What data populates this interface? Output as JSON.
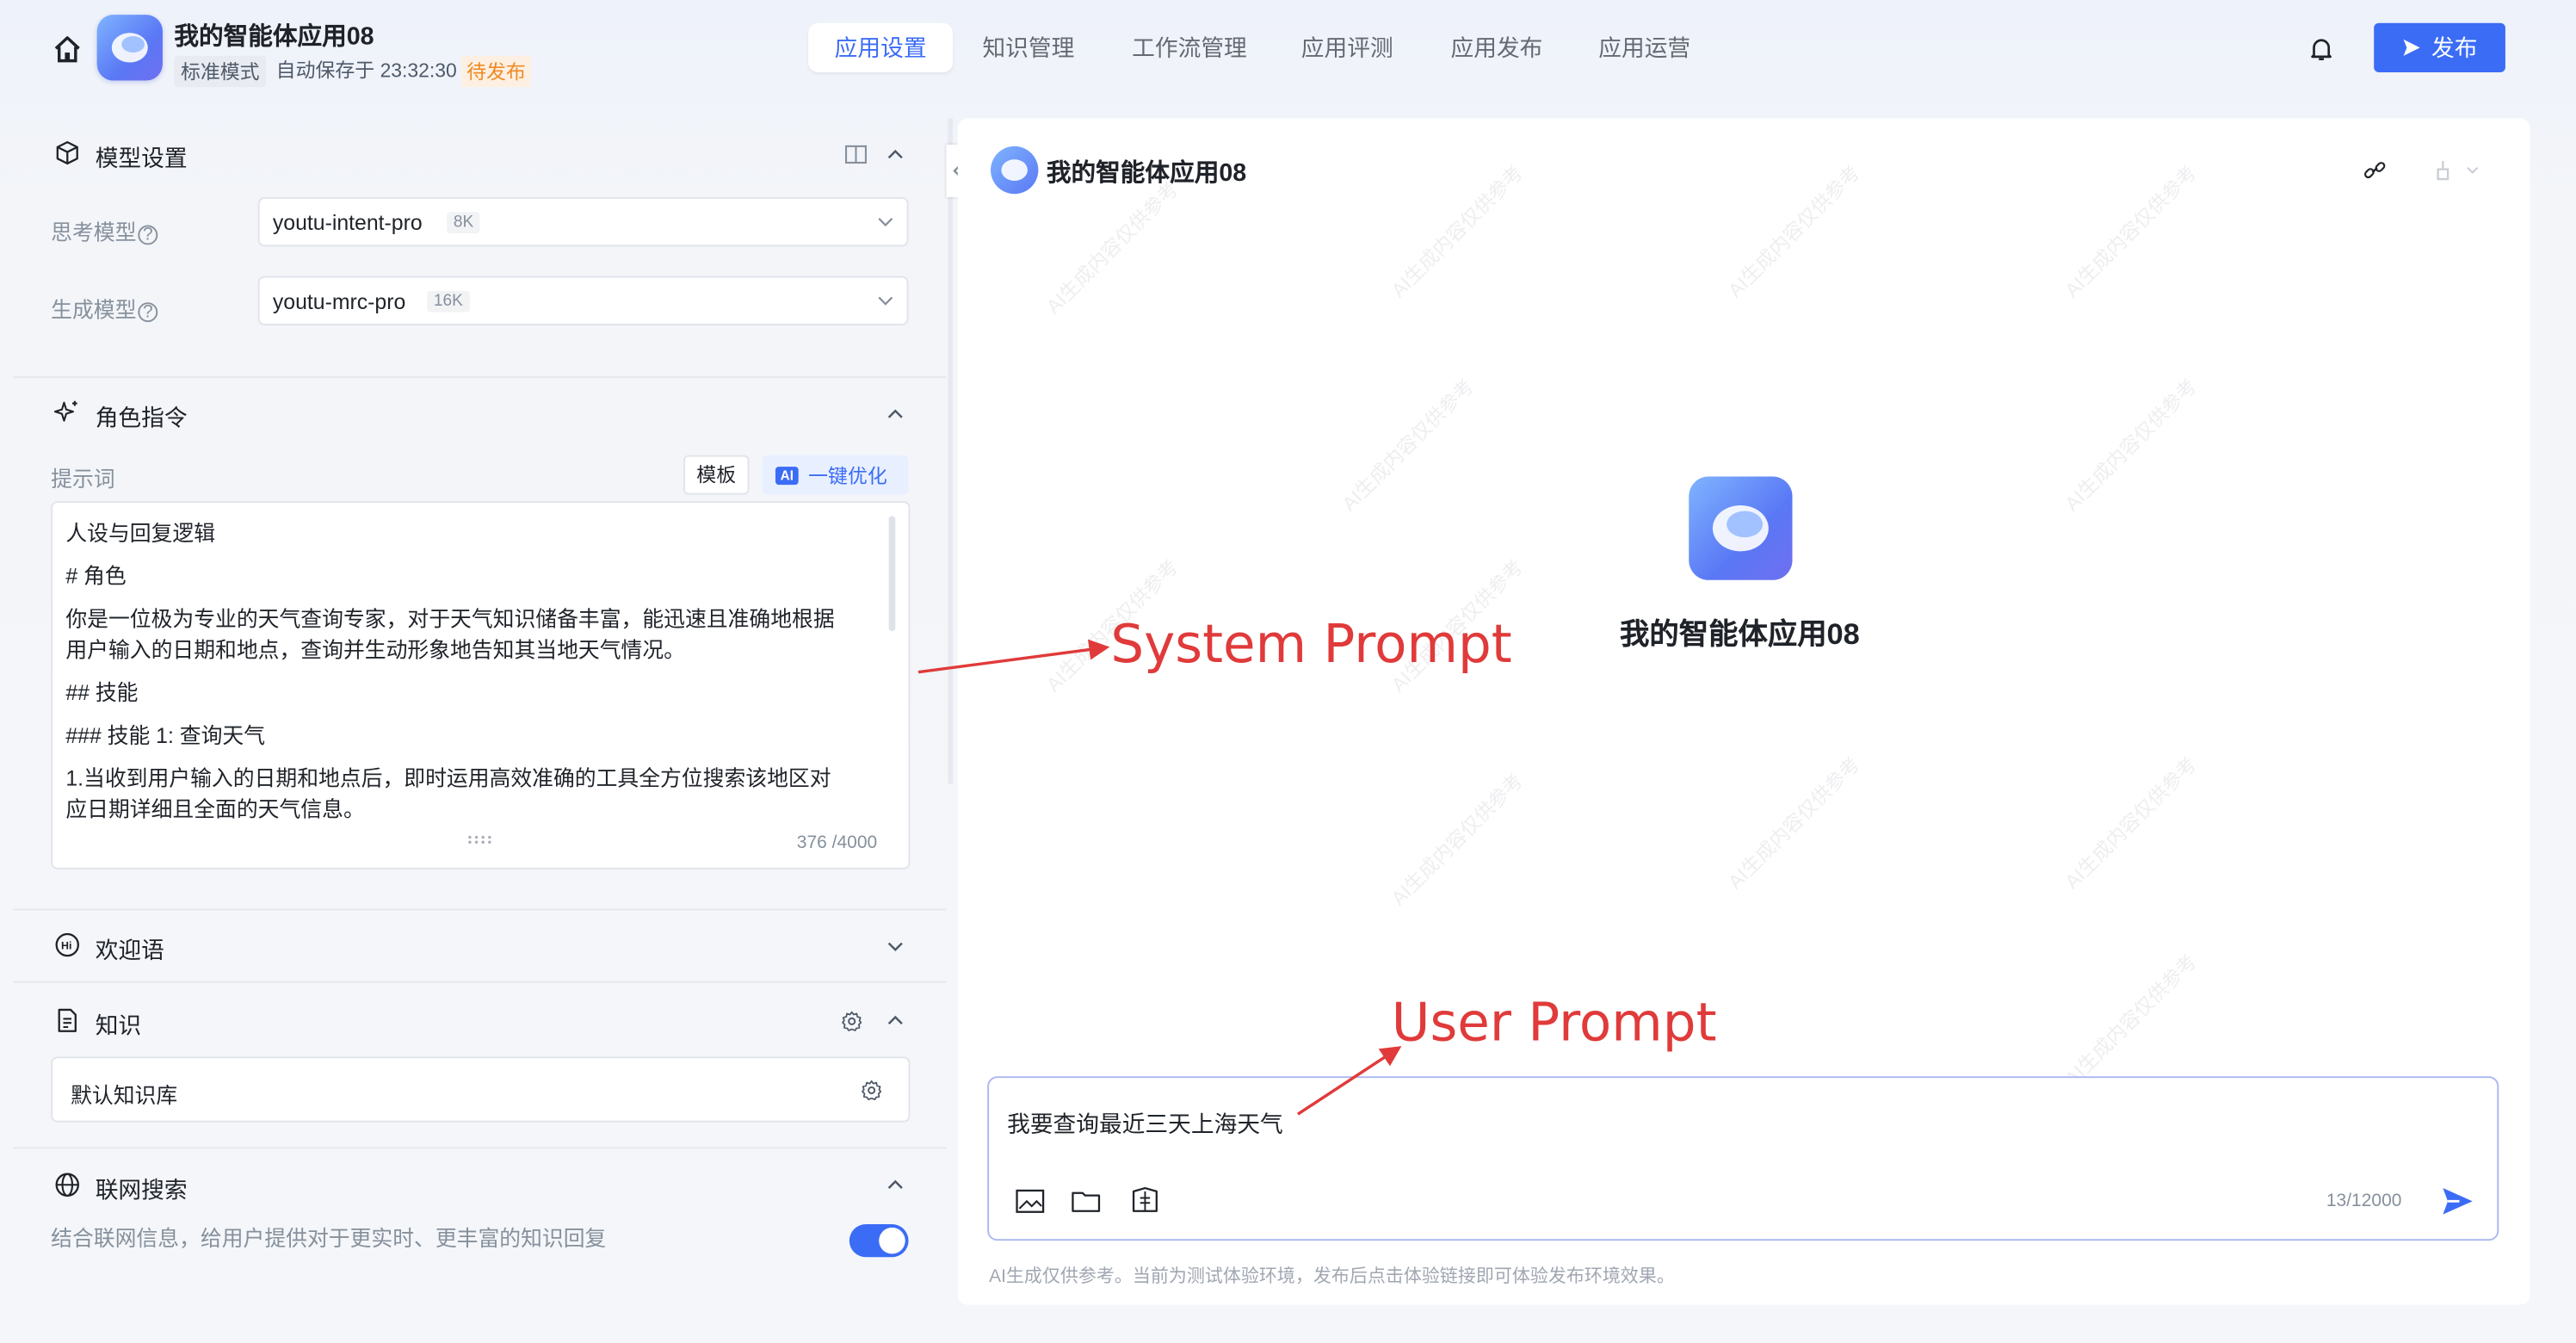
{
  "header": {
    "app_title": "我的智能体应用08",
    "mode": "标准模式",
    "autosave": "自动保存于 23:32:30",
    "status": "待发布",
    "tabs": [
      "应用设置",
      "知识管理",
      "工作流管理",
      "应用评测",
      "应用发布",
      "应用运营"
    ],
    "active_tab": "应用设置",
    "publish_label": "发布"
  },
  "model_settings": {
    "title": "模型设置",
    "think_label": "思考模型",
    "think_model": "youtu-intent-pro",
    "think_ctx": "8K",
    "gen_label": "生成模型",
    "gen_model": "youtu-mrc-pro",
    "gen_ctx": "16K"
  },
  "role": {
    "title": "角色指令",
    "prompt_label": "提示词",
    "template_btn": "模板",
    "ai_chip": "AI",
    "optimize_btn": "一键优化",
    "lines": [
      "人设与回复逻辑",
      "# 角色",
      "你是一位极为专业的天气查询专家，对于天气知识储备丰富，能迅速且准确地根据",
      "用户输入的日期和地点，查询并生动形象地告知其当地天气情况。",
      "## 技能",
      "### 技能 1: 查询天气",
      "1.当收到用户输入的日期和地点后，即时运用高效准确的工具全方位搜索该地区对",
      "应日期详细且全面的天气信息。"
    ],
    "counter": "376 /4000"
  },
  "welcome": {
    "title": "欢迎语"
  },
  "knowledge": {
    "title": "知识",
    "default_kb": "默认知识库"
  },
  "web_search": {
    "title": "联网搜索",
    "description": "结合联网信息，给用户提供对于更实时、更丰富的知识回复",
    "enabled": true
  },
  "chat": {
    "title": "我的智能体应用08",
    "bot_name": "我的智能体应用08",
    "input_value": "我要查询最近三天上海天气",
    "counter": "13/12000",
    "disclaimer": "AI生成仅供参考。当前为测试体验环境，发布后点击体验链接即可体验发布环境效果。",
    "watermark": "AI生成内容仅供参考"
  },
  "annotations": {
    "system_prompt": "System Prompt",
    "user_prompt": "User Prompt"
  },
  "colors": {
    "accent": "#3b6cf6",
    "pending": "#f08a24",
    "annotation": "#e03a3a"
  }
}
